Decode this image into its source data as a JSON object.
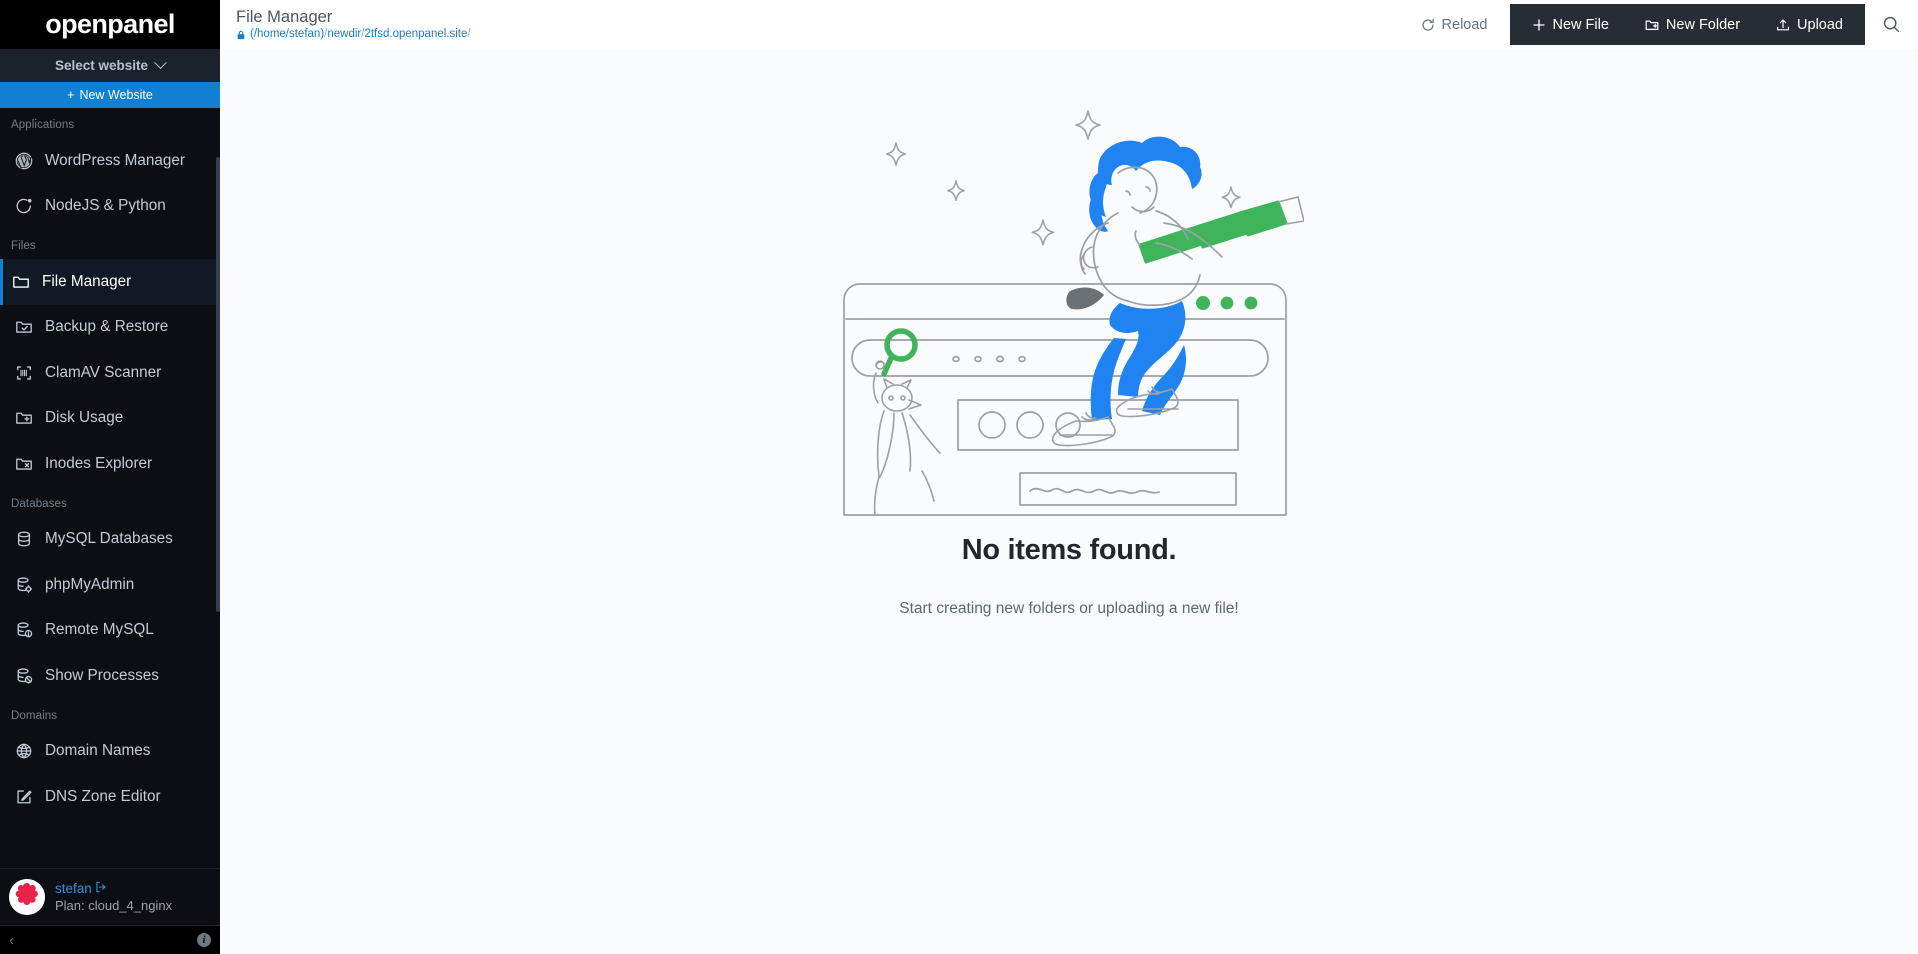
{
  "brand": {
    "name": "openpanel"
  },
  "sidebar": {
    "site_select": {
      "label": "Select website",
      "icon": "chevron-down-icon"
    },
    "new_website": {
      "label": "New Website",
      "icon": "plus-icon",
      "color": "#1180d0"
    },
    "sections": [
      {
        "title": "Applications",
        "items": [
          {
            "label": "WordPress Manager",
            "icon": "wordpress-icon",
            "active": false
          },
          {
            "label": "NodeJS & Python",
            "icon": "nodejs-icon",
            "active": false
          }
        ]
      },
      {
        "title": "Files",
        "items": [
          {
            "label": "File Manager",
            "icon": "folder-icon",
            "active": true
          },
          {
            "label": "Backup & Restore",
            "icon": "folder-check-icon",
            "active": false
          },
          {
            "label": "ClamAV Scanner",
            "icon": "scan-icon",
            "active": false
          },
          {
            "label": "Disk Usage",
            "icon": "folder-plus-icon",
            "active": false
          },
          {
            "label": "Inodes Explorer",
            "icon": "folder-x-icon",
            "active": false
          }
        ]
      },
      {
        "title": "Databases",
        "items": [
          {
            "label": "MySQL Databases",
            "icon": "database-icon",
            "active": false
          },
          {
            "label": "phpMyAdmin",
            "icon": "database-cog-icon",
            "active": false
          },
          {
            "label": "Remote MySQL",
            "icon": "database-info-icon",
            "active": false
          },
          {
            "label": "Show Processes",
            "icon": "database-ban-icon",
            "active": false
          }
        ]
      },
      {
        "title": "Domains",
        "items": [
          {
            "label": "Domain Names",
            "icon": "globe-icon",
            "active": false
          },
          {
            "label": "DNS Zone Editor",
            "icon": "edit-square-icon",
            "active": false
          }
        ]
      }
    ],
    "user": {
      "name": "stefan",
      "logout_icon": "logout-icon",
      "plan": "Plan: cloud_4_nginx",
      "avatar_icon": "avatar-icon"
    },
    "footer": {
      "collapse_icon": "chevron-left-icon",
      "info_icon": "info-icon"
    }
  },
  "header": {
    "title": "File Manager",
    "breadcrumb": {
      "lock_icon": "lock-icon",
      "root": "(/home/stefan)",
      "segments": [
        "newdir",
        "2tfsd.openpanel.site"
      ],
      "trailing_sep": "/"
    },
    "reload": {
      "label": "Reload",
      "icon": "reload-icon"
    },
    "actions": [
      {
        "label": "New File",
        "icon": "plus-icon"
      },
      {
        "label": "New Folder",
        "icon": "folder-plus-icon"
      },
      {
        "label": "Upload",
        "icon": "upload-icon"
      }
    ],
    "search": {
      "icon": "search-icon"
    }
  },
  "empty_state": {
    "illustration": "woman-with-telescope-on-browser-window",
    "title": "No items found.",
    "subtitle": "Start creating new folders or uploading a new file!"
  },
  "colors": {
    "accent_blue": "#1180d0",
    "sidebar_bg": "#0b0f14",
    "toolbar_dark": "#272c35",
    "content_bg": "#fafbfc",
    "illustration_blue": "#1f83f2",
    "illustration_green": "#3fb45a",
    "avatar_red": "#e8234a"
  }
}
